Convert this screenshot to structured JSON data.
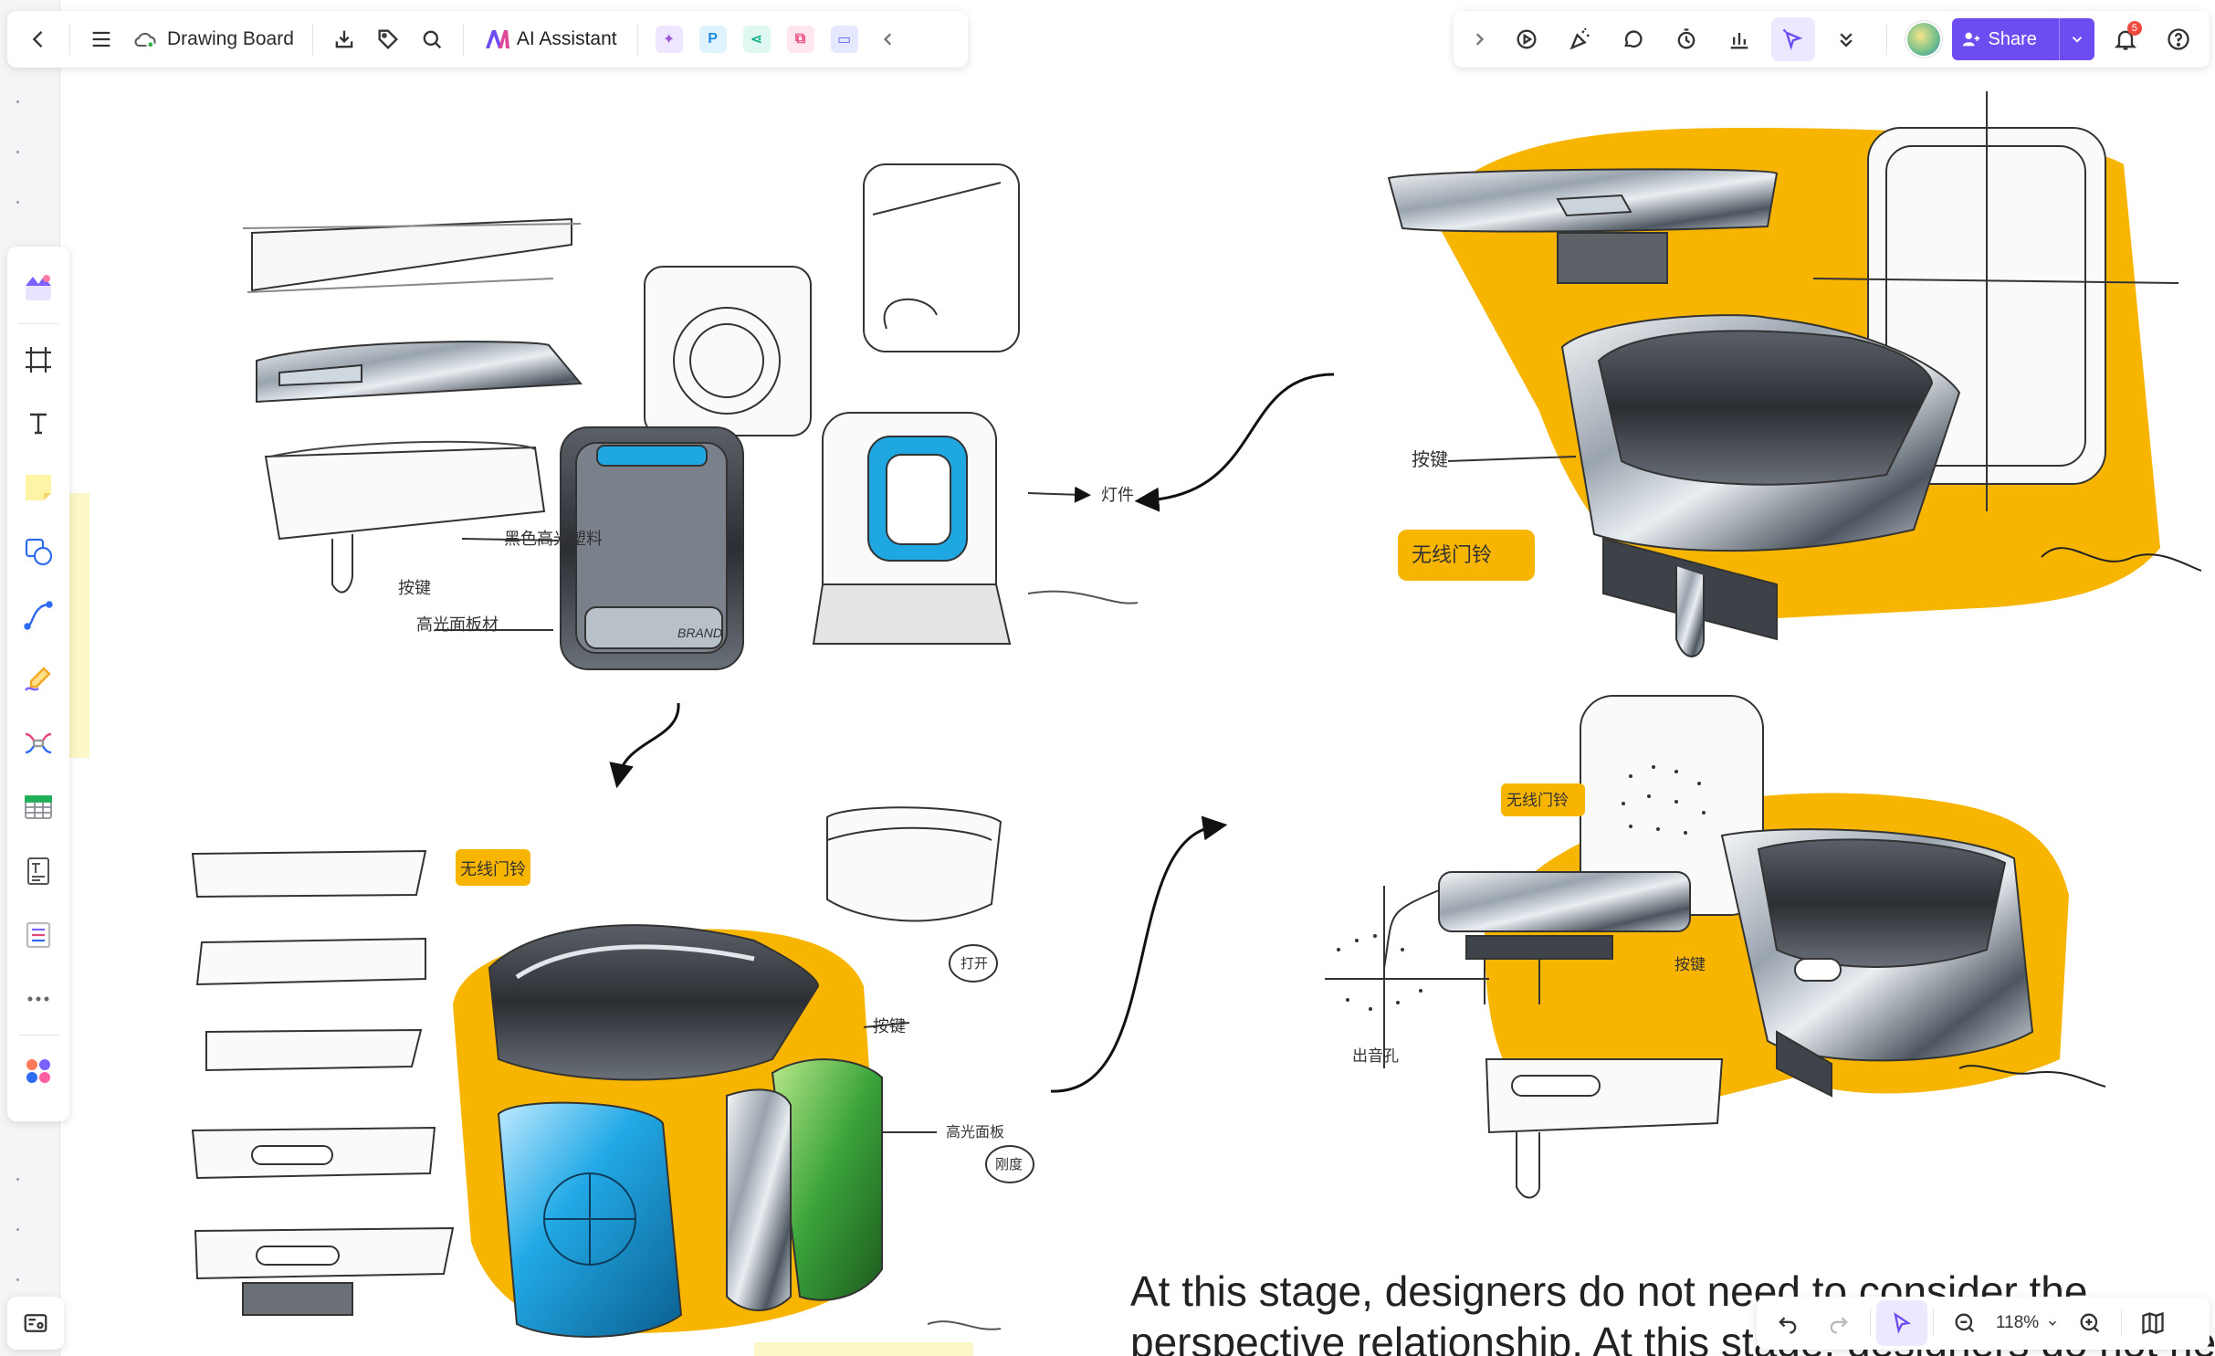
{
  "toolbar": {
    "title": "Drawing Board",
    "ai_label": "AI Assistant",
    "share_label": "Share",
    "notification_count": "5"
  },
  "canvas": {
    "annotations": {
      "a1": "黑色高光塑料",
      "a2": "按键",
      "a3": "高光面板材",
      "a4": "灯件",
      "a5": "按键",
      "a6": "无线门铃",
      "a7": "无线门铃",
      "a8": "按键",
      "a9": "打开",
      "a10": "无线门铃",
      "a11": "按键",
      "a12": "出音孔",
      "a13": "高光面板",
      "a14": "刚度"
    },
    "brand_text": "BRAND"
  },
  "caption": {
    "line1": "At this stage, designers do not need to consider the",
    "line2": "perspective relationship. At this stage, designers do not need"
  },
  "bottom": {
    "zoom": "118%"
  },
  "colors": {
    "accent": "#6d4df2",
    "marker_yellow": "#f7b500",
    "marker_blue": "#1ea7e0",
    "marker_green": "#3aa33a"
  }
}
